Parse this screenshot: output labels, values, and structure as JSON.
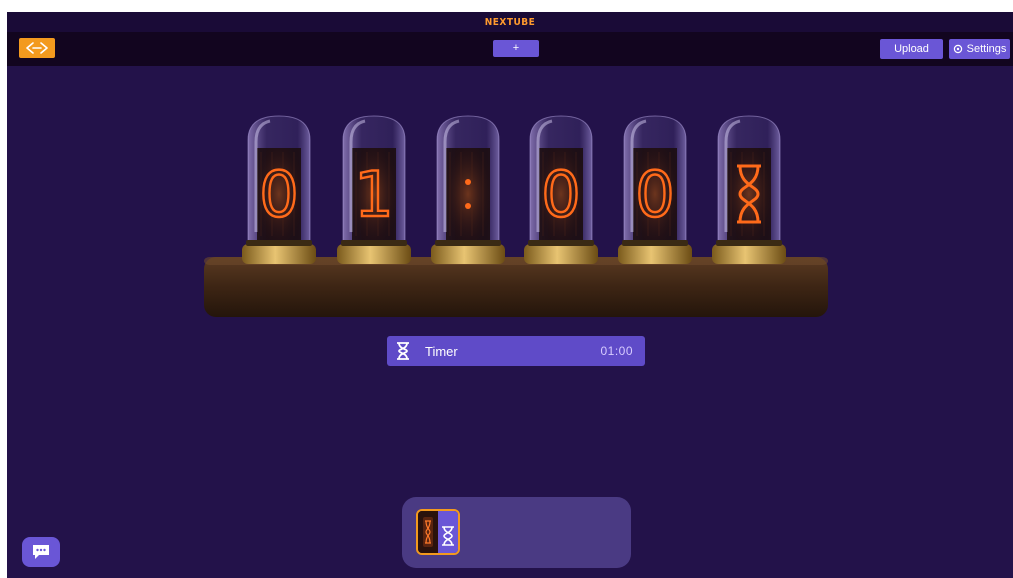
{
  "app": {
    "title": "NEXTUBE"
  },
  "toolbar": {
    "back_icon": "code-arrows-icon",
    "add_label": "+",
    "upload_label": "Upload",
    "settings_label": "Settings",
    "settings_icon": "gear-icon"
  },
  "clock": {
    "digits": [
      "0",
      "1",
      ":",
      "0",
      "0",
      "hourglass"
    ],
    "mode_icon": "hourglass-icon"
  },
  "timer": {
    "label": "Timer",
    "value": "01:00",
    "icon": "hourglass-icon"
  },
  "tray": {
    "items": [
      {
        "name": "timer-mode-thumbnail",
        "selected": true
      }
    ]
  },
  "chat": {
    "icon": "chat-bubble-icon"
  },
  "colors": {
    "background": "#23124a",
    "toolbar": "#12051f",
    "accent_orange": "#f39a1e",
    "button_purple": "#6a56d6",
    "tray": "#4a3a83",
    "nixie_glow": "#ff6a1a"
  }
}
